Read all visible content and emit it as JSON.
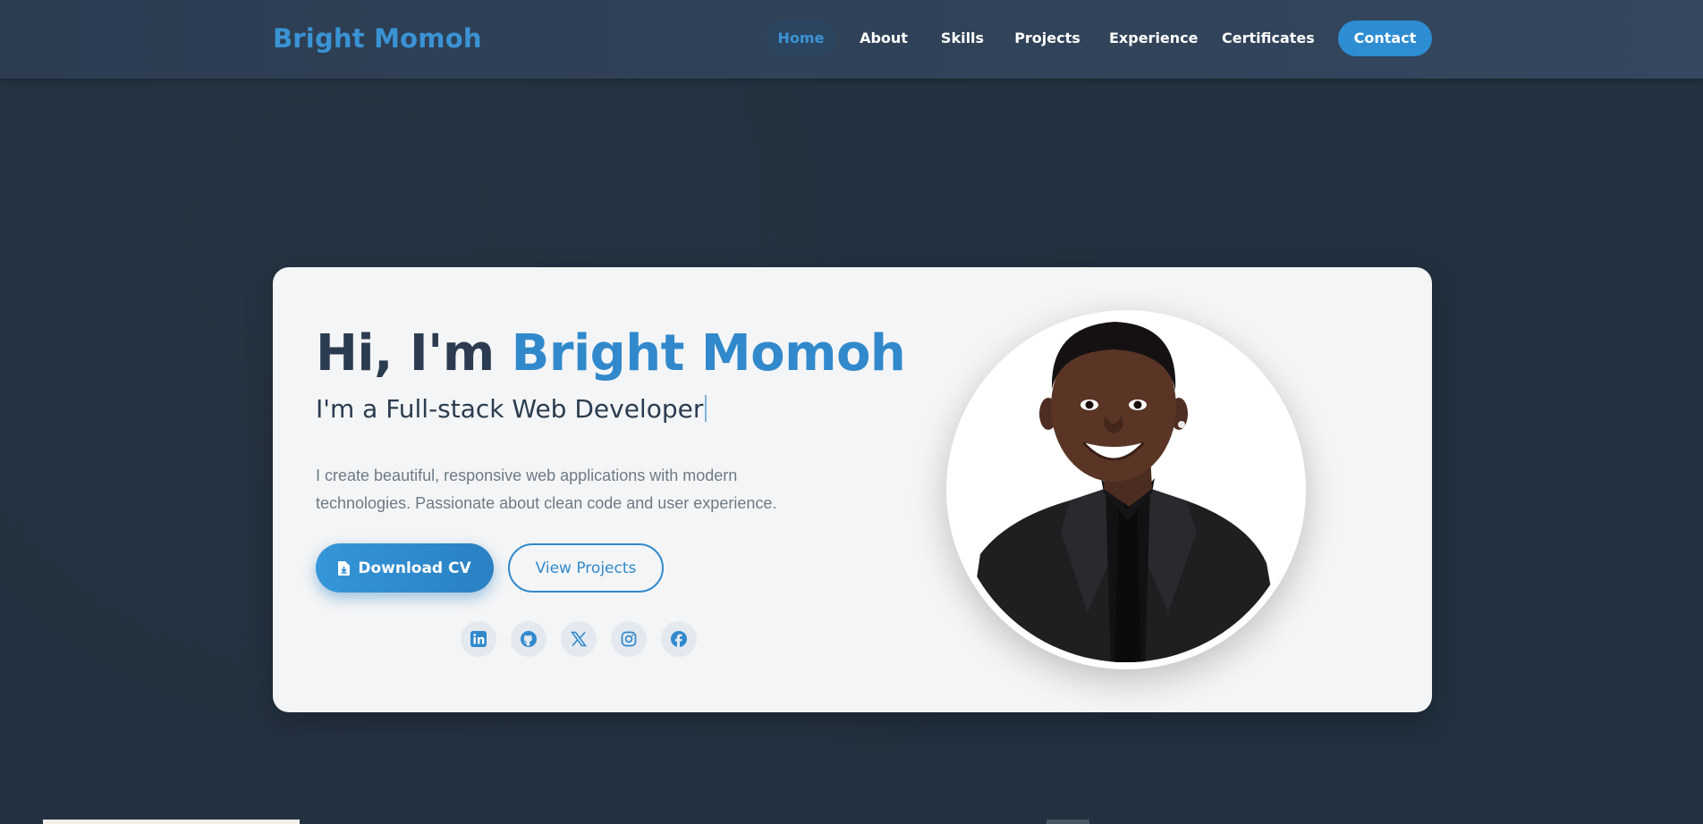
{
  "brand": {
    "name": "Bright Momoh",
    "accent": "#3a93d4"
  },
  "nav": {
    "home": "Home",
    "about": "About",
    "skills": "Skills",
    "projects": "Projects",
    "experience": "Experience",
    "certificates": "Certificates",
    "contact": "Contact"
  },
  "hero": {
    "greeting": "Hi, I'm ",
    "name": "Bright Momoh",
    "subtitle": "I'm a Full-stack Web Developer",
    "description": "I create beautiful, responsive web applications with modern technologies. Passionate about clean code and user experience.",
    "download_cv": "Download CV",
    "view_projects": "View Projects"
  },
  "socials": [
    {
      "icon": "linkedin-icon"
    },
    {
      "icon": "github-icon"
    },
    {
      "icon": "x-twitter-icon"
    },
    {
      "icon": "instagram-icon"
    },
    {
      "icon": "facebook-icon"
    }
  ],
  "colors": {
    "background": "#22303f",
    "navbar": "#2c3d52",
    "card": "#f4f5f6",
    "primary": "#3189cc",
    "heading": "#2b3c50",
    "muted": "#6e7a86"
  }
}
